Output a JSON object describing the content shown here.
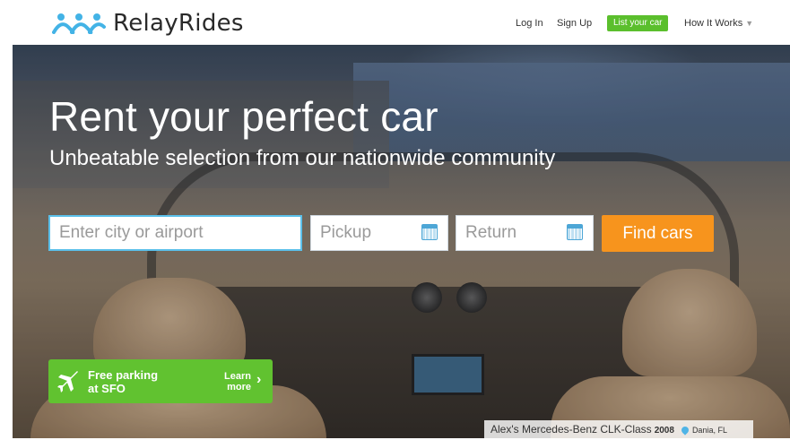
{
  "header": {
    "brand": "RelayRides",
    "nav": {
      "login": "Log In",
      "signup": "Sign Up",
      "list_car": "List your car",
      "how_it_works": "How It Works",
      "how_caret": "▼"
    }
  },
  "hero": {
    "headline": "Rent your perfect car",
    "subline": "Unbeatable selection from our nationwide community"
  },
  "search": {
    "city_placeholder": "Enter city or airport",
    "pickup_placeholder": "Pickup",
    "return_placeholder": "Return",
    "submit_label": "Find cars"
  },
  "promo": {
    "line1": "Free parking",
    "line2": "at SFO",
    "learn1": "Learn",
    "learn2": "more",
    "chevron": "›"
  },
  "caption": {
    "car": "Alex's Mercedes-Benz CLK-Class",
    "year": "2008",
    "location": "Dania, FL"
  },
  "colors": {
    "accent_orange": "#f7941d",
    "accent_green": "#5bbf2d",
    "accent_blue": "#5bc0ea"
  },
  "icons": {
    "logo": "people-group-icon",
    "calendar": "calendar-icon",
    "plane": "airplane-icon",
    "pin": "map-pin-icon"
  }
}
